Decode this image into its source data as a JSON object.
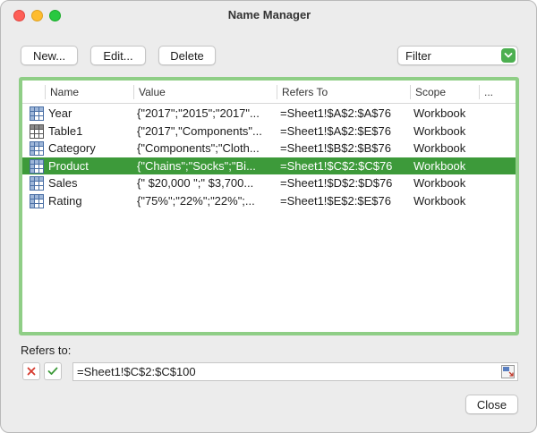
{
  "window": {
    "title": "Name Manager"
  },
  "toolbar": {
    "new_label": "New...",
    "edit_label": "Edit...",
    "delete_label": "Delete"
  },
  "filter": {
    "label": "Filter",
    "icon": "chevron-down-icon",
    "accent": "#4caf50"
  },
  "list": {
    "headers": {
      "name": "Name",
      "value": "Value",
      "refers_to": "Refers To",
      "scope": "Scope",
      "more": "..."
    },
    "rows": [
      {
        "icon": "named-range-icon",
        "name": "Year",
        "value": "{\"2017\";\"2015\";\"2017\"...",
        "refers_to": "=Sheet1!$A$2:$A$76",
        "scope": "Workbook",
        "selected": false
      },
      {
        "icon": "table-icon",
        "name": "Table1",
        "value": "{\"2017\",\"Components\"...",
        "refers_to": "=Sheet1!$A$2:$E$76",
        "scope": "Workbook",
        "selected": false
      },
      {
        "icon": "named-range-icon",
        "name": "Category",
        "value": "{\"Components\";\"Cloth...",
        "refers_to": "=Sheet1!$B$2:$B$76",
        "scope": "Workbook",
        "selected": false
      },
      {
        "icon": "named-range-icon",
        "name": "Product",
        "value": "{\"Chains\";\"Socks\";\"Bi...",
        "refers_to": "=Sheet1!$C$2:$C$76",
        "scope": "Workbook",
        "selected": true
      },
      {
        "icon": "named-range-icon",
        "name": "Sales",
        "value": "{\" $20,000 \";\" $3,700...",
        "refers_to": "=Sheet1!$D$2:$D$76",
        "scope": "Workbook",
        "selected": false
      },
      {
        "icon": "named-range-icon",
        "name": "Rating",
        "value": "{\"75%\";\"22%\";\"22%\";...",
        "refers_to": "=Sheet1!$E$2:$E$76",
        "scope": "Workbook",
        "selected": false
      }
    ],
    "selection_color": "#3d9a3a",
    "focus_border_color": "#8fce86"
  },
  "refers_to": {
    "label": "Refers to:",
    "value": "=Sheet1!$C$2:$C$100",
    "cancel_icon": "cancel-x-icon",
    "confirm_icon": "checkmark-icon",
    "collapse_icon": "collapse-dialog-icon"
  },
  "footer": {
    "close_label": "Close"
  }
}
